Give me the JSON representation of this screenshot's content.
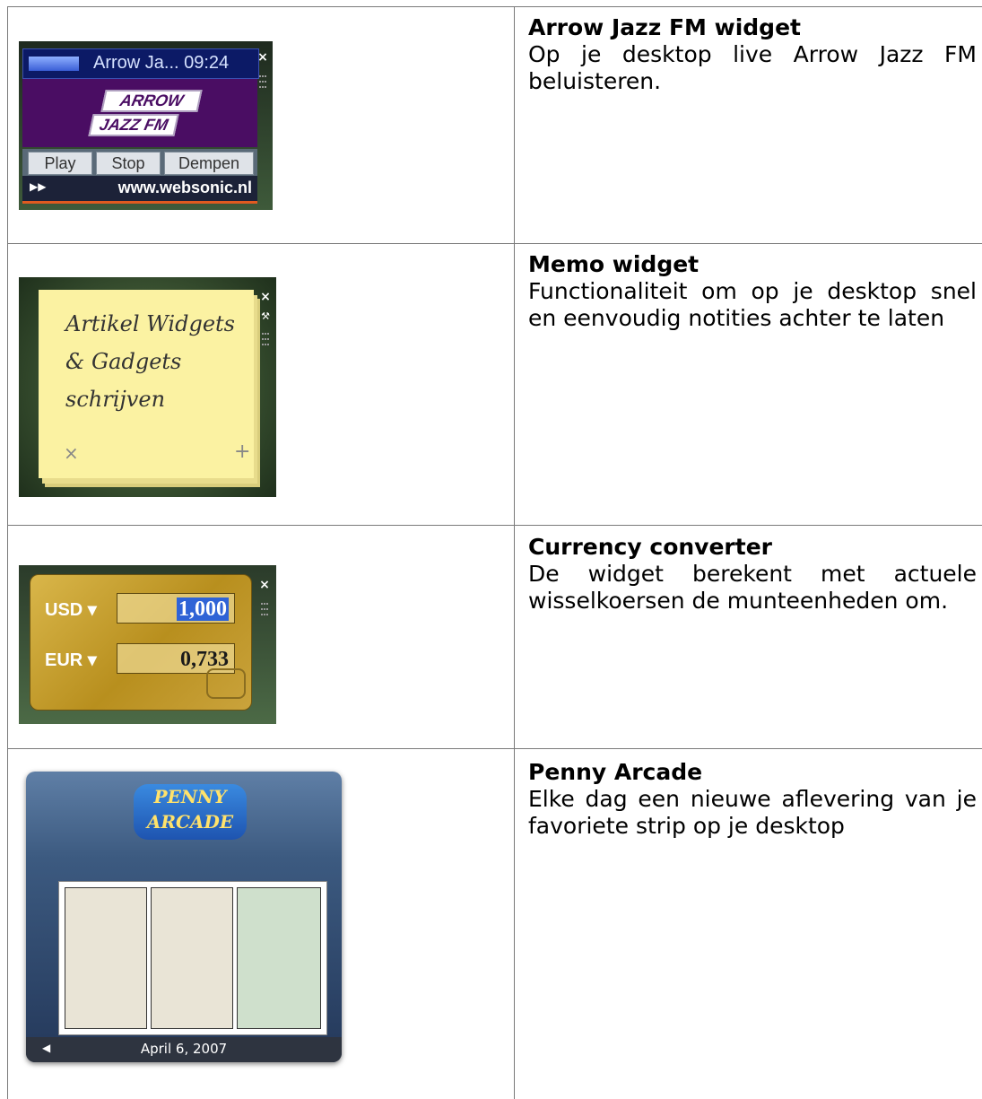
{
  "rows": [
    {
      "title": "Arrow Jazz FM widget",
      "description": "Op je desktop live Arrow Jazz FM beluisteren.",
      "widget": {
        "display": "Arrow Ja... 09:24",
        "logo_line1": "ARROW",
        "logo_line2": "JAZZ FM",
        "buttons": [
          "Play",
          "Stop",
          "Dempen"
        ],
        "footer_url": "www.websonic.nl",
        "footer_icon": "fast-forward-icon",
        "colors": {
          "display_bg": "#0c1a66",
          "logo_bg": "#4a0d63",
          "accent": "#e05a20"
        }
      }
    },
    {
      "title": "Memo widget",
      "description": "Functionaliteit om op je desktop snel en eenvoudig notities achter te laten",
      "widget": {
        "note_lines": [
          "Artikel Widgets",
          "& Gadgets",
          "schrijven"
        ],
        "delete_icon": "close-icon",
        "add_icon": "plus-icon",
        "colors": {
          "paper": "#fbf2a2"
        }
      }
    },
    {
      "title": "Currency converter",
      "description": "De widget berekent met actuele wisselkoersen de munteenheden om.",
      "widget": {
        "from_currency": "USD",
        "from_value": "1,000",
        "to_currency": "EUR",
        "to_value": "0,733",
        "colors": {
          "card": "#c9a232",
          "selection": "#2f63d6"
        }
      }
    },
    {
      "title": "Penny Arcade",
      "description": "Elke dag een nieuwe aflevering van je favoriete strip op je desktop",
      "widget": {
        "logo_line1": "PENNY",
        "logo_line2": "ARCADE",
        "date": "April 6, 2007",
        "prev_icon": "triangle-left-icon",
        "colors": {
          "frame": "#3c5a80"
        }
      }
    }
  ]
}
